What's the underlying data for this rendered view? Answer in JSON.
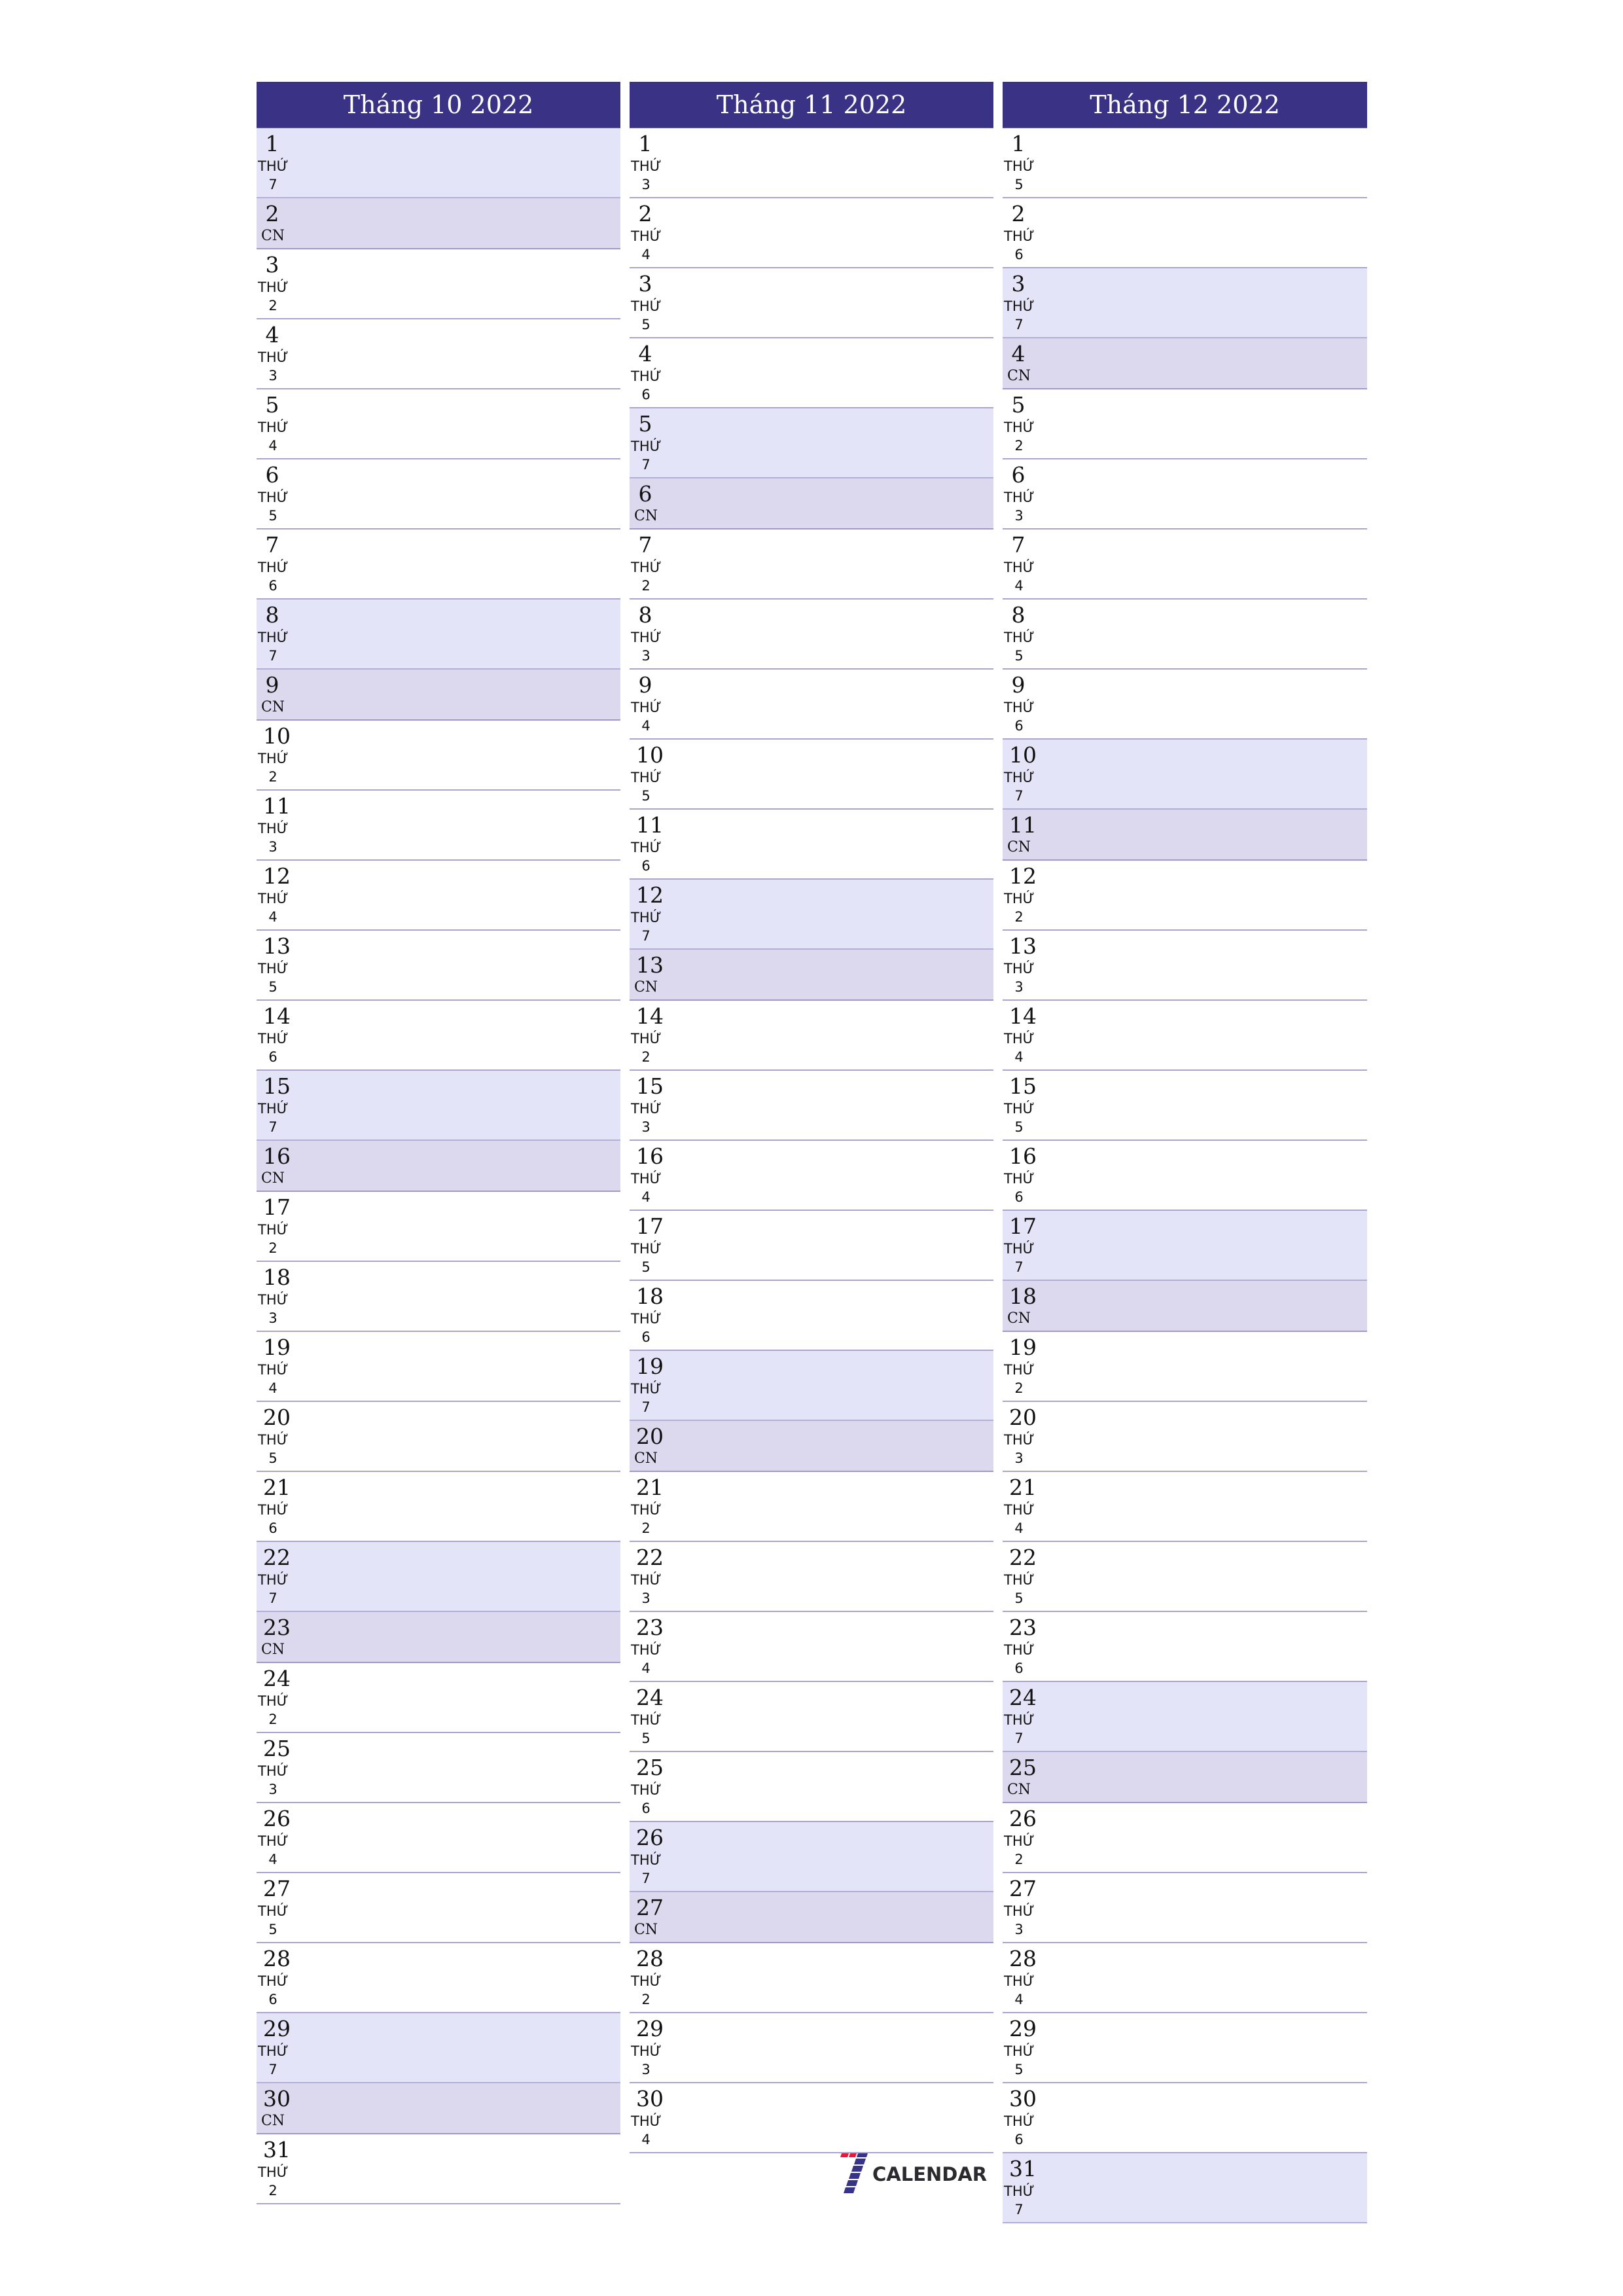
{
  "months": [
    {
      "title": "Tháng 10 2022",
      "days": [
        {
          "day": "1",
          "label": "THỨ\n7",
          "type": "sat"
        },
        {
          "day": "2",
          "label": "CN",
          "type": "sun"
        },
        {
          "day": "3",
          "label": "THỨ\n2",
          "type": "weekday"
        },
        {
          "day": "4",
          "label": "THỨ\n3",
          "type": "weekday"
        },
        {
          "day": "5",
          "label": "THỨ\n4",
          "type": "weekday"
        },
        {
          "day": "6",
          "label": "THỨ\n5",
          "type": "weekday"
        },
        {
          "day": "7",
          "label": "THỨ\n6",
          "type": "weekday"
        },
        {
          "day": "8",
          "label": "THỨ\n7",
          "type": "sat"
        },
        {
          "day": "9",
          "label": "CN",
          "type": "sun"
        },
        {
          "day": "10",
          "label": "THỨ\n2",
          "type": "weekday"
        },
        {
          "day": "11",
          "label": "THỨ\n3",
          "type": "weekday"
        },
        {
          "day": "12",
          "label": "THỨ\n4",
          "type": "weekday"
        },
        {
          "day": "13",
          "label": "THỨ\n5",
          "type": "weekday"
        },
        {
          "day": "14",
          "label": "THỨ\n6",
          "type": "weekday"
        },
        {
          "day": "15",
          "label": "THỨ\n7",
          "type": "sat"
        },
        {
          "day": "16",
          "label": "CN",
          "type": "sun"
        },
        {
          "day": "17",
          "label": "THỨ\n2",
          "type": "weekday"
        },
        {
          "day": "18",
          "label": "THỨ\n3",
          "type": "weekday"
        },
        {
          "day": "19",
          "label": "THỨ\n4",
          "type": "weekday"
        },
        {
          "day": "20",
          "label": "THỨ\n5",
          "type": "weekday"
        },
        {
          "day": "21",
          "label": "THỨ\n6",
          "type": "weekday"
        },
        {
          "day": "22",
          "label": "THỨ\n7",
          "type": "sat"
        },
        {
          "day": "23",
          "label": "CN",
          "type": "sun"
        },
        {
          "day": "24",
          "label": "THỨ\n2",
          "type": "weekday"
        },
        {
          "day": "25",
          "label": "THỨ\n3",
          "type": "weekday"
        },
        {
          "day": "26",
          "label": "THỨ\n4",
          "type": "weekday"
        },
        {
          "day": "27",
          "label": "THỨ\n5",
          "type": "weekday"
        },
        {
          "day": "28",
          "label": "THỨ\n6",
          "type": "weekday"
        },
        {
          "day": "29",
          "label": "THỨ\n7",
          "type": "sat"
        },
        {
          "day": "30",
          "label": "CN",
          "type": "sun"
        },
        {
          "day": "31",
          "label": "THỨ\n2",
          "type": "weekday"
        }
      ]
    },
    {
      "title": "Tháng 11 2022",
      "days": [
        {
          "day": "1",
          "label": "THỨ\n3",
          "type": "weekday"
        },
        {
          "day": "2",
          "label": "THỨ\n4",
          "type": "weekday"
        },
        {
          "day": "3",
          "label": "THỨ\n5",
          "type": "weekday"
        },
        {
          "day": "4",
          "label": "THỨ\n6",
          "type": "weekday"
        },
        {
          "day": "5",
          "label": "THỨ\n7",
          "type": "sat"
        },
        {
          "day": "6",
          "label": "CN",
          "type": "sun"
        },
        {
          "day": "7",
          "label": "THỨ\n2",
          "type": "weekday"
        },
        {
          "day": "8",
          "label": "THỨ\n3",
          "type": "weekday"
        },
        {
          "day": "9",
          "label": "THỨ\n4",
          "type": "weekday"
        },
        {
          "day": "10",
          "label": "THỨ\n5",
          "type": "weekday"
        },
        {
          "day": "11",
          "label": "THỨ\n6",
          "type": "weekday"
        },
        {
          "day": "12",
          "label": "THỨ\n7",
          "type": "sat"
        },
        {
          "day": "13",
          "label": "CN",
          "type": "sun"
        },
        {
          "day": "14",
          "label": "THỨ\n2",
          "type": "weekday"
        },
        {
          "day": "15",
          "label": "THỨ\n3",
          "type": "weekday"
        },
        {
          "day": "16",
          "label": "THỨ\n4",
          "type": "weekday"
        },
        {
          "day": "17",
          "label": "THỨ\n5",
          "type": "weekday"
        },
        {
          "day": "18",
          "label": "THỨ\n6",
          "type": "weekday"
        },
        {
          "day": "19",
          "label": "THỨ\n7",
          "type": "sat"
        },
        {
          "day": "20",
          "label": "CN",
          "type": "sun"
        },
        {
          "day": "21",
          "label": "THỨ\n2",
          "type": "weekday"
        },
        {
          "day": "22",
          "label": "THỨ\n3",
          "type": "weekday"
        },
        {
          "day": "23",
          "label": "THỨ\n4",
          "type": "weekday"
        },
        {
          "day": "24",
          "label": "THỨ\n5",
          "type": "weekday"
        },
        {
          "day": "25",
          "label": "THỨ\n6",
          "type": "weekday"
        },
        {
          "day": "26",
          "label": "THỨ\n7",
          "type": "sat"
        },
        {
          "day": "27",
          "label": "CN",
          "type": "sun"
        },
        {
          "day": "28",
          "label": "THỨ\n2",
          "type": "weekday"
        },
        {
          "day": "29",
          "label": "THỨ\n3",
          "type": "weekday"
        },
        {
          "day": "30",
          "label": "THỨ\n4",
          "type": "weekday"
        }
      ]
    },
    {
      "title": "Tháng 12 2022",
      "days": [
        {
          "day": "1",
          "label": "THỨ\n5",
          "type": "weekday"
        },
        {
          "day": "2",
          "label": "THỨ\n6",
          "type": "weekday"
        },
        {
          "day": "3",
          "label": "THỨ\n7",
          "type": "sat"
        },
        {
          "day": "4",
          "label": "CN",
          "type": "sun"
        },
        {
          "day": "5",
          "label": "THỨ\n2",
          "type": "weekday"
        },
        {
          "day": "6",
          "label": "THỨ\n3",
          "type": "weekday"
        },
        {
          "day": "7",
          "label": "THỨ\n4",
          "type": "weekday"
        },
        {
          "day": "8",
          "label": "THỨ\n5",
          "type": "weekday"
        },
        {
          "day": "9",
          "label": "THỨ\n6",
          "type": "weekday"
        },
        {
          "day": "10",
          "label": "THỨ\n7",
          "type": "sat"
        },
        {
          "day": "11",
          "label": "CN",
          "type": "sun"
        },
        {
          "day": "12",
          "label": "THỨ\n2",
          "type": "weekday"
        },
        {
          "day": "13",
          "label": "THỨ\n3",
          "type": "weekday"
        },
        {
          "day": "14",
          "label": "THỨ\n4",
          "type": "weekday"
        },
        {
          "day": "15",
          "label": "THỨ\n5",
          "type": "weekday"
        },
        {
          "day": "16",
          "label": "THỨ\n6",
          "type": "weekday"
        },
        {
          "day": "17",
          "label": "THỨ\n7",
          "type": "sat"
        },
        {
          "day": "18",
          "label": "CN",
          "type": "sun"
        },
        {
          "day": "19",
          "label": "THỨ\n2",
          "type": "weekday"
        },
        {
          "day": "20",
          "label": "THỨ\n3",
          "type": "weekday"
        },
        {
          "day": "21",
          "label": "THỨ\n4",
          "type": "weekday"
        },
        {
          "day": "22",
          "label": "THỨ\n5",
          "type": "weekday"
        },
        {
          "day": "23",
          "label": "THỨ\n6",
          "type": "weekday"
        },
        {
          "day": "24",
          "label": "THỨ\n7",
          "type": "sat"
        },
        {
          "day": "25",
          "label": "CN",
          "type": "sun"
        },
        {
          "day": "26",
          "label": "THỨ\n2",
          "type": "weekday"
        },
        {
          "day": "27",
          "label": "THỨ\n3",
          "type": "weekday"
        },
        {
          "day": "28",
          "label": "THỨ\n4",
          "type": "weekday"
        },
        {
          "day": "29",
          "label": "THỨ\n5",
          "type": "weekday"
        },
        {
          "day": "30",
          "label": "THỨ\n6",
          "type": "weekday"
        },
        {
          "day": "31",
          "label": "THỨ\n7",
          "type": "sat"
        }
      ]
    }
  ],
  "logo": {
    "text": "CALENDAR",
    "icon": "seven-stripes-logo-icon"
  },
  "colors": {
    "header": "#3a3385",
    "saturday": "#e4e4f8",
    "sunday": "#dcd8ee",
    "logo_red": "#e8173d",
    "logo_blue": "#373388"
  }
}
